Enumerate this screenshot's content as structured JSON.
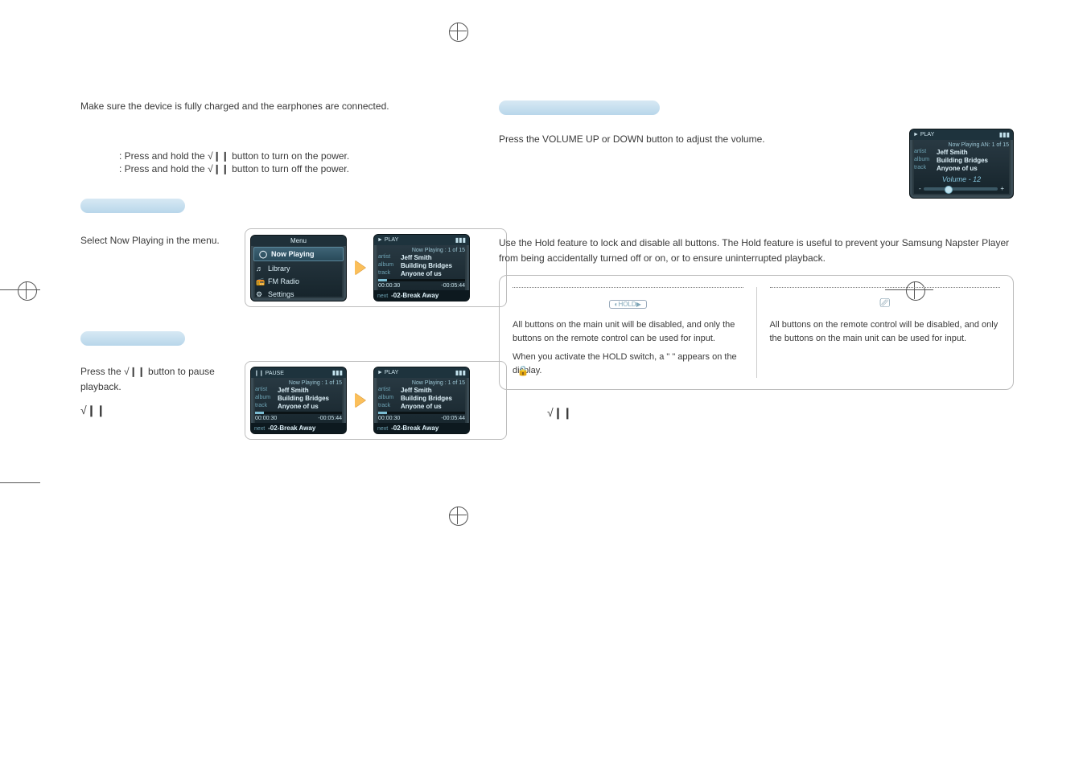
{
  "intro": "Make sure the device is fully charged and the earphones are connected.",
  "power": {
    "on": ": Press and hold the √❙❙ button to turn on the power.",
    "off": ": Press and hold the √❙❙ button to turn off the power."
  },
  "left": {
    "playing": {
      "line": "Select Now Playing in the menu."
    },
    "pausing": {
      "line": "Press the √❙❙ button to pause playback.",
      "glyph": "√❙❙"
    }
  },
  "right": {
    "volume": {
      "line": "Press the VOLUME UP or DOWN button to adjust the volume."
    },
    "hold": {
      "intro": "Use the Hold feature to lock and disable all buttons. The Hold feature is useful to prevent your Samsung Napster Player from being accidentally turned off or on, or to ensure uninterrupted playback.",
      "main": {
        "l1": "All buttons on the main unit will be disabled, and only the buttons on the remote control can be used for input.",
        "l2": "When you activate the HOLD switch, a \"       \" appears on the display."
      },
      "remote": {
        "l1": "All buttons on the remote control will be disabled, and only the buttons on the main unit can be used for input."
      },
      "glyph": "√❙❙"
    }
  },
  "device": {
    "menu": {
      "title": "Menu",
      "items": [
        "Now Playing",
        "Library",
        "FM Radio",
        "Settings"
      ]
    },
    "play": {
      "state_play": "► PLAY",
      "state_pause": "❙❙ PAUSE",
      "nowplaying": "Now Playing : 1 of 15",
      "nowplaying_alt": "Now Playing AN: 1 of 15",
      "artist_lbl": "artist",
      "artist": "Jeff Smith",
      "album_lbl": "album",
      "album": "Building Bridges",
      "track_lbl": "track",
      "track": "Anyone of us",
      "elapsed": "00:00:30",
      "remain": "-00:05:44",
      "next_lbl": "next",
      "next": "-02-Break Away"
    },
    "volume": {
      "label": "Volume - 12",
      "minus": "-",
      "plus": "+"
    }
  }
}
